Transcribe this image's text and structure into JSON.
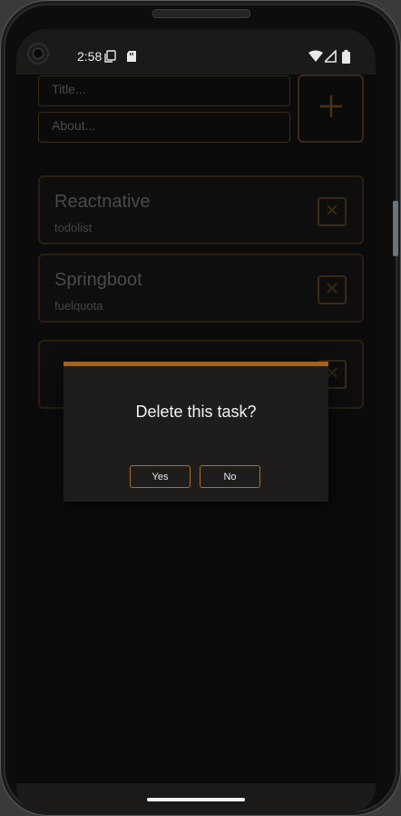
{
  "status_bar": {
    "time": "2:58",
    "icons": [
      "screenshot-icon",
      "sd-card-icon",
      "wifi-icon",
      "signal-icon",
      "battery-icon"
    ]
  },
  "form": {
    "title_placeholder": "Title...",
    "about_placeholder": "About...",
    "add_icon": "plus-icon"
  },
  "tasks": [
    {
      "title": "Reactnative",
      "subtitle": "todolist"
    },
    {
      "title": "Springboot",
      "subtitle": "fuelquota"
    },
    {
      "title": "",
      "subtitle": ""
    }
  ],
  "dialog": {
    "title": "Delete this task?",
    "yes_label": "Yes",
    "no_label": "No"
  },
  "colors": {
    "accent": "#a5621e",
    "button_border": "#b36b23",
    "dialog_bg": "#1f1d1b",
    "screen_bg": "#0b0b0b"
  }
}
